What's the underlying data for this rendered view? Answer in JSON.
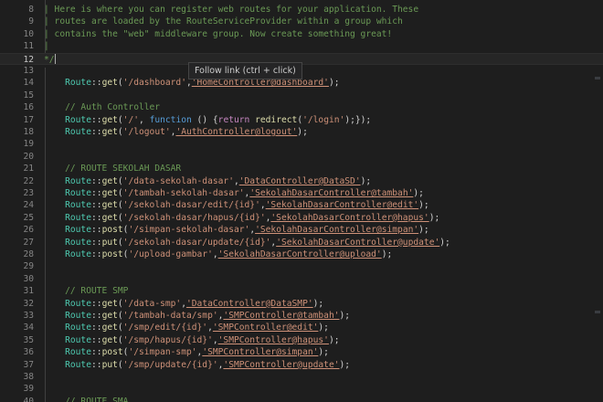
{
  "tooltip": "Follow link (ctrl + click)",
  "lines": [
    {
      "n": "8",
      "tokens": [
        {
          "t": "| Here is where you can register web routes for your application. These",
          "c": "comment"
        }
      ]
    },
    {
      "n": "9",
      "tokens": [
        {
          "t": "| routes are loaded by the RouteServiceProvider within a group which",
          "c": "comment"
        }
      ]
    },
    {
      "n": "10",
      "tokens": [
        {
          "t": "| contains the \"web\" middleware group. Now create something great!",
          "c": "comment"
        }
      ]
    },
    {
      "n": "11",
      "tokens": [
        {
          "t": "|",
          "c": "comment"
        }
      ]
    },
    {
      "n": "12",
      "active": true,
      "tokens": [
        {
          "t": "*/",
          "c": "comment"
        }
      ],
      "cursor": true
    },
    {
      "n": "13",
      "tokens": []
    },
    {
      "n": "14",
      "tokens": [
        {
          "t": "    "
        },
        {
          "t": "Route",
          "c": "class"
        },
        {
          "t": "::",
          "c": "punc"
        },
        {
          "t": "get",
          "c": "func"
        },
        {
          "t": "(",
          "c": "punc"
        },
        {
          "t": "'/dashboard'",
          "c": "str"
        },
        {
          "t": ",",
          "c": "punc"
        },
        {
          "t": "'HomeController@dashboard'",
          "c": "str",
          "link": true
        },
        {
          "t": ");",
          "c": "punc"
        }
      ]
    },
    {
      "n": "15",
      "tokens": []
    },
    {
      "n": "16",
      "tokens": [
        {
          "t": "    "
        },
        {
          "t": "// Auth Controller",
          "c": "comment"
        }
      ]
    },
    {
      "n": "17",
      "tokens": [
        {
          "t": "    "
        },
        {
          "t": "Route",
          "c": "class"
        },
        {
          "t": "::",
          "c": "punc"
        },
        {
          "t": "get",
          "c": "func"
        },
        {
          "t": "(",
          "c": "punc"
        },
        {
          "t": "'/'",
          "c": "str"
        },
        {
          "t": ", ",
          "c": "punc"
        },
        {
          "t": "function",
          "c": "kw"
        },
        {
          "t": " () {",
          "c": "punc"
        },
        {
          "t": "return",
          "c": "ctl"
        },
        {
          "t": " "
        },
        {
          "t": "redirect",
          "c": "func"
        },
        {
          "t": "(",
          "c": "punc"
        },
        {
          "t": "'/login'",
          "c": "str"
        },
        {
          "t": ");});",
          "c": "punc"
        }
      ]
    },
    {
      "n": "18",
      "tokens": [
        {
          "t": "    "
        },
        {
          "t": "Route",
          "c": "class"
        },
        {
          "t": "::",
          "c": "punc"
        },
        {
          "t": "get",
          "c": "func"
        },
        {
          "t": "(",
          "c": "punc"
        },
        {
          "t": "'/logout'",
          "c": "str"
        },
        {
          "t": ",",
          "c": "punc"
        },
        {
          "t": "'AuthController@logout'",
          "c": "str",
          "link": true
        },
        {
          "t": ");",
          "c": "punc"
        }
      ]
    },
    {
      "n": "19",
      "tokens": []
    },
    {
      "n": "20",
      "tokens": []
    },
    {
      "n": "21",
      "tokens": [
        {
          "t": "    "
        },
        {
          "t": "// ROUTE SEKOLAH DASAR",
          "c": "comment"
        }
      ]
    },
    {
      "n": "22",
      "tokens": [
        {
          "t": "    "
        },
        {
          "t": "Route",
          "c": "class"
        },
        {
          "t": "::",
          "c": "punc"
        },
        {
          "t": "get",
          "c": "func"
        },
        {
          "t": "(",
          "c": "punc"
        },
        {
          "t": "'/data-sekolah-dasar'",
          "c": "str"
        },
        {
          "t": ",",
          "c": "punc"
        },
        {
          "t": "'DataController@DataSD'",
          "c": "str",
          "link": true
        },
        {
          "t": ");",
          "c": "punc"
        }
      ]
    },
    {
      "n": "23",
      "tokens": [
        {
          "t": "    "
        },
        {
          "t": "Route",
          "c": "class"
        },
        {
          "t": "::",
          "c": "punc"
        },
        {
          "t": "get",
          "c": "func"
        },
        {
          "t": "(",
          "c": "punc"
        },
        {
          "t": "'/tambah-sekolah-dasar'",
          "c": "str"
        },
        {
          "t": ",",
          "c": "punc"
        },
        {
          "t": "'SekolahDasarController@tambah'",
          "c": "str",
          "link": true
        },
        {
          "t": ");",
          "c": "punc"
        }
      ]
    },
    {
      "n": "24",
      "tokens": [
        {
          "t": "    "
        },
        {
          "t": "Route",
          "c": "class"
        },
        {
          "t": "::",
          "c": "punc"
        },
        {
          "t": "get",
          "c": "func"
        },
        {
          "t": "(",
          "c": "punc"
        },
        {
          "t": "'/sekolah-dasar/edit/{id}'",
          "c": "str"
        },
        {
          "t": ",",
          "c": "punc"
        },
        {
          "t": "'SekolahDasarController@edit'",
          "c": "str",
          "link": true
        },
        {
          "t": ");",
          "c": "punc"
        }
      ]
    },
    {
      "n": "25",
      "tokens": [
        {
          "t": "    "
        },
        {
          "t": "Route",
          "c": "class"
        },
        {
          "t": "::",
          "c": "punc"
        },
        {
          "t": "get",
          "c": "func"
        },
        {
          "t": "(",
          "c": "punc"
        },
        {
          "t": "'/sekolah-dasar/hapus/{id}'",
          "c": "str"
        },
        {
          "t": ",",
          "c": "punc"
        },
        {
          "t": "'SekolahDasarController@hapus'",
          "c": "str",
          "link": true
        },
        {
          "t": ");",
          "c": "punc"
        }
      ]
    },
    {
      "n": "26",
      "tokens": [
        {
          "t": "    "
        },
        {
          "t": "Route",
          "c": "class"
        },
        {
          "t": "::",
          "c": "punc"
        },
        {
          "t": "post",
          "c": "func"
        },
        {
          "t": "(",
          "c": "punc"
        },
        {
          "t": "'/simpan-sekolah-dasar'",
          "c": "str"
        },
        {
          "t": ",",
          "c": "punc"
        },
        {
          "t": "'SekolahDasarController@simpan'",
          "c": "str",
          "link": true
        },
        {
          "t": ");",
          "c": "punc"
        }
      ]
    },
    {
      "n": "27",
      "tokens": [
        {
          "t": "    "
        },
        {
          "t": "Route",
          "c": "class"
        },
        {
          "t": "::",
          "c": "punc"
        },
        {
          "t": "put",
          "c": "func"
        },
        {
          "t": "(",
          "c": "punc"
        },
        {
          "t": "'/sekolah-dasar/update/{id}'",
          "c": "str"
        },
        {
          "t": ",",
          "c": "punc"
        },
        {
          "t": "'SekolahDasarController@update'",
          "c": "str",
          "link": true
        },
        {
          "t": ");",
          "c": "punc"
        }
      ]
    },
    {
      "n": "28",
      "tokens": [
        {
          "t": "    "
        },
        {
          "t": "Route",
          "c": "class"
        },
        {
          "t": "::",
          "c": "punc"
        },
        {
          "t": "post",
          "c": "func"
        },
        {
          "t": "(",
          "c": "punc"
        },
        {
          "t": "'/upload-gambar'",
          "c": "str"
        },
        {
          "t": ",",
          "c": "punc"
        },
        {
          "t": "'SekolahDasarController@upload'",
          "c": "str",
          "link": true
        },
        {
          "t": ");",
          "c": "punc"
        }
      ]
    },
    {
      "n": "29",
      "tokens": []
    },
    {
      "n": "30",
      "tokens": []
    },
    {
      "n": "31",
      "tokens": [
        {
          "t": "    "
        },
        {
          "t": "// ROUTE SMP",
          "c": "comment"
        }
      ]
    },
    {
      "n": "32",
      "tokens": [
        {
          "t": "    "
        },
        {
          "t": "Route",
          "c": "class"
        },
        {
          "t": "::",
          "c": "punc"
        },
        {
          "t": "get",
          "c": "func"
        },
        {
          "t": "(",
          "c": "punc"
        },
        {
          "t": "'/data-smp'",
          "c": "str"
        },
        {
          "t": ",",
          "c": "punc"
        },
        {
          "t": "'DataController@DataSMP'",
          "c": "str",
          "link": true
        },
        {
          "t": ");",
          "c": "punc"
        }
      ]
    },
    {
      "n": "33",
      "tokens": [
        {
          "t": "    "
        },
        {
          "t": "Route",
          "c": "class"
        },
        {
          "t": "::",
          "c": "punc"
        },
        {
          "t": "get",
          "c": "func"
        },
        {
          "t": "(",
          "c": "punc"
        },
        {
          "t": "'/tambah-data/smp'",
          "c": "str"
        },
        {
          "t": ",",
          "c": "punc"
        },
        {
          "t": "'SMPController@tambah'",
          "c": "str",
          "link": true
        },
        {
          "t": ");",
          "c": "punc"
        }
      ]
    },
    {
      "n": "34",
      "tokens": [
        {
          "t": "    "
        },
        {
          "t": "Route",
          "c": "class"
        },
        {
          "t": "::",
          "c": "punc"
        },
        {
          "t": "get",
          "c": "func"
        },
        {
          "t": "(",
          "c": "punc"
        },
        {
          "t": "'/smp/edit/{id}'",
          "c": "str"
        },
        {
          "t": ",",
          "c": "punc"
        },
        {
          "t": "'SMPController@edit'",
          "c": "str",
          "link": true
        },
        {
          "t": ");",
          "c": "punc"
        }
      ]
    },
    {
      "n": "35",
      "tokens": [
        {
          "t": "    "
        },
        {
          "t": "Route",
          "c": "class"
        },
        {
          "t": "::",
          "c": "punc"
        },
        {
          "t": "get",
          "c": "func"
        },
        {
          "t": "(",
          "c": "punc"
        },
        {
          "t": "'/smp/hapus/{id}'",
          "c": "str"
        },
        {
          "t": ",",
          "c": "punc"
        },
        {
          "t": "'SMPController@hapus'",
          "c": "str",
          "link": true
        },
        {
          "t": ");",
          "c": "punc"
        }
      ]
    },
    {
      "n": "36",
      "tokens": [
        {
          "t": "    "
        },
        {
          "t": "Route",
          "c": "class"
        },
        {
          "t": "::",
          "c": "punc"
        },
        {
          "t": "post",
          "c": "func"
        },
        {
          "t": "(",
          "c": "punc"
        },
        {
          "t": "'/simpan-smp'",
          "c": "str"
        },
        {
          "t": ",",
          "c": "punc"
        },
        {
          "t": "'SMPController@simpan'",
          "c": "str",
          "link": true
        },
        {
          "t": ");",
          "c": "punc"
        }
      ]
    },
    {
      "n": "37",
      "tokens": [
        {
          "t": "    "
        },
        {
          "t": "Route",
          "c": "class"
        },
        {
          "t": "::",
          "c": "punc"
        },
        {
          "t": "put",
          "c": "func"
        },
        {
          "t": "(",
          "c": "punc"
        },
        {
          "t": "'/smp/update/{id}'",
          "c": "str"
        },
        {
          "t": ",",
          "c": "punc"
        },
        {
          "t": "'SMPController@update'",
          "c": "str",
          "link": true
        },
        {
          "t": ");",
          "c": "punc"
        }
      ]
    },
    {
      "n": "38",
      "tokens": []
    },
    {
      "n": "39",
      "tokens": []
    },
    {
      "n": "40",
      "tokens": [
        {
          "t": "    "
        },
        {
          "t": "// ROUTE SMA",
          "c": "comment"
        }
      ]
    }
  ]
}
